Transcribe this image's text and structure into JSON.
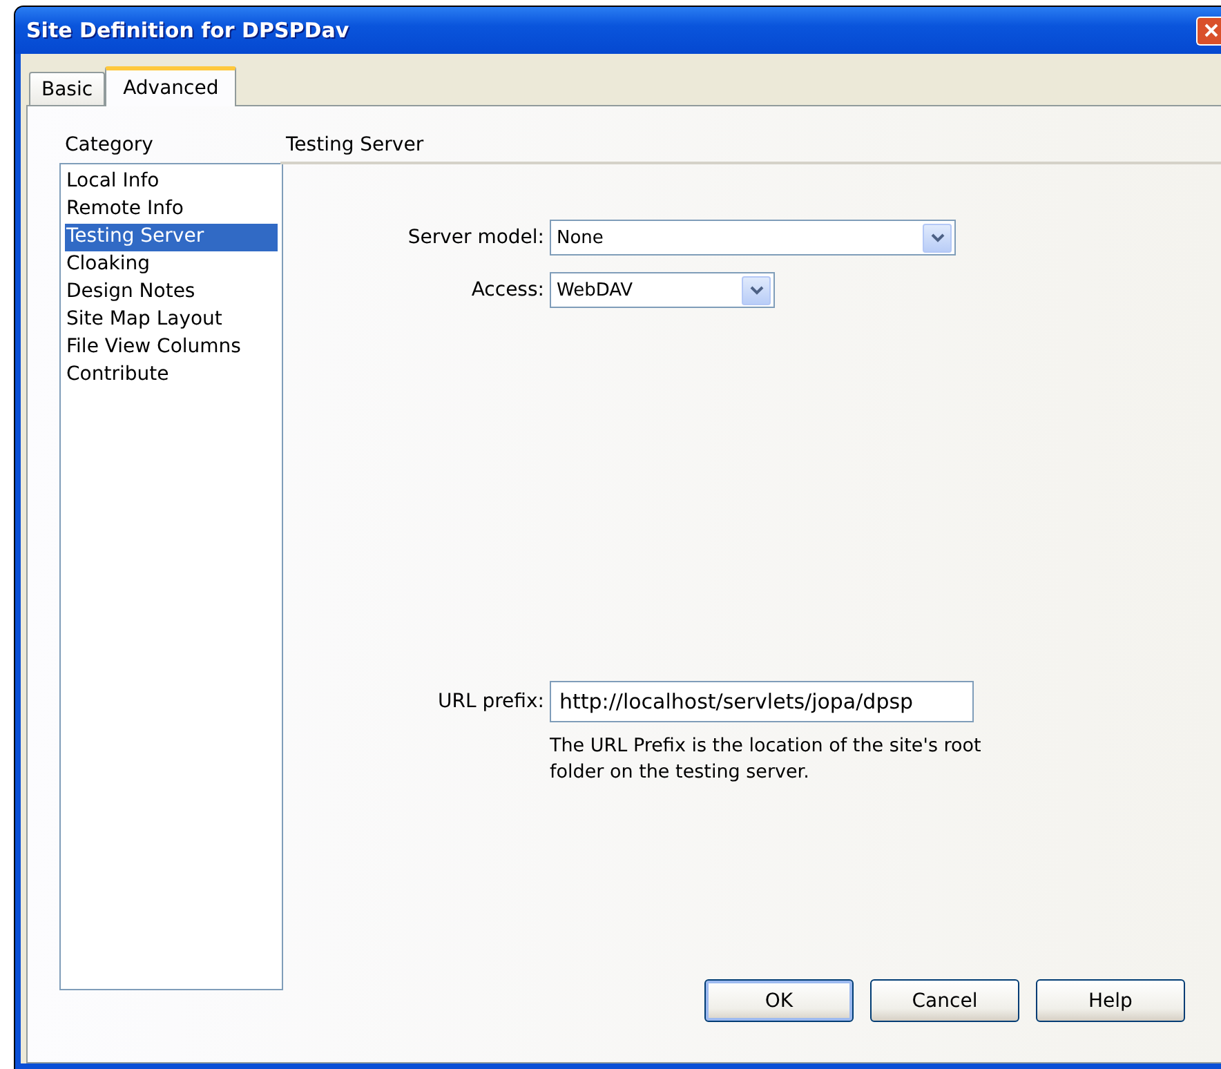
{
  "window": {
    "title": "Site Definition for DPSPDav"
  },
  "tabs": [
    {
      "label": "Basic",
      "selected": false
    },
    {
      "label": "Advanced",
      "selected": true
    }
  ],
  "category": {
    "label": "Category",
    "items": [
      {
        "label": "Local Info",
        "selected": false
      },
      {
        "label": "Remote Info",
        "selected": false
      },
      {
        "label": "Testing Server",
        "selected": true
      },
      {
        "label": "Cloaking",
        "selected": false
      },
      {
        "label": "Design Notes",
        "selected": false
      },
      {
        "label": "Site Map Layout",
        "selected": false
      },
      {
        "label": "File View Columns",
        "selected": false
      },
      {
        "label": "Contribute",
        "selected": false
      }
    ]
  },
  "section": {
    "title": "Testing Server"
  },
  "server_model": {
    "label": "Server model:",
    "value": "None"
  },
  "access": {
    "label": "Access:",
    "value": "WebDAV"
  },
  "url_prefix": {
    "label": "URL prefix:",
    "value": "http://localhost/servlets/jopa/dpsp",
    "hint": "The URL Prefix is the location of the site's root folder on the testing server."
  },
  "buttons": [
    {
      "label": "OK",
      "default": true
    },
    {
      "label": "Cancel",
      "default": false
    },
    {
      "label": "Help",
      "default": false
    }
  ]
}
